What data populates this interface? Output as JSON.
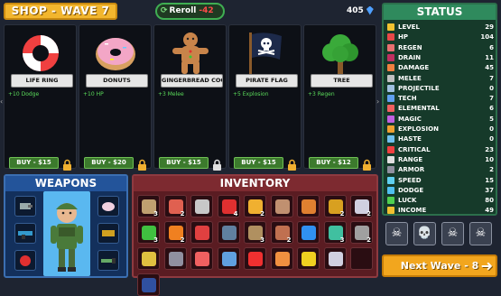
{
  "header": {
    "shop_title": "SHOP - WAVE 7",
    "reroll_label": "Reroll",
    "reroll_cost": "-42",
    "gold": "405"
  },
  "shop": [
    {
      "name": "LIFE RING",
      "effect": "+10 Dodge",
      "buy": "BUY - $15",
      "icon": "life-ring"
    },
    {
      "name": "DONUTS",
      "effect": "+10 HP",
      "buy": "BUY - $20",
      "icon": "donut"
    },
    {
      "name": "GINGERBREAD COOKIE",
      "effect": "+3 Melee",
      "buy": "BUY - $15",
      "icon": "gingerbread"
    },
    {
      "name": "PIRATE FLAG",
      "effect": "+5 Explosion",
      "buy": "BUY - $15",
      "icon": "pirate-flag"
    },
    {
      "name": "TREE",
      "effect": "+3 Regen",
      "buy": "BUY - $12",
      "icon": "tree"
    }
  ],
  "status": {
    "title": "STATUS",
    "stats": [
      {
        "label": "LEVEL",
        "value": "29",
        "color": "#f2c230"
      },
      {
        "label": "HP",
        "value": "104",
        "color": "#e84848"
      },
      {
        "label": "REGEN",
        "value": "6",
        "color": "#e87070"
      },
      {
        "label": "DRAIN",
        "value": "11",
        "color": "#c03060"
      },
      {
        "label": "DAMAGE",
        "value": "45",
        "color": "#f08040"
      },
      {
        "label": "MELEE",
        "value": "7",
        "color": "#c0c0c0"
      },
      {
        "label": "PROJECTILE",
        "value": "0",
        "color": "#a0c0e0"
      },
      {
        "label": "TECH",
        "value": "7",
        "color": "#60a0f0"
      },
      {
        "label": "ELEMENTAL",
        "value": "6",
        "color": "#f06060"
      },
      {
        "label": "MAGIC",
        "value": "5",
        "color": "#c060e0"
      },
      {
        "label": "EXPLOSION",
        "value": "0",
        "color": "#f0a030"
      },
      {
        "label": "HASTE",
        "value": "0",
        "color": "#70c0f0"
      },
      {
        "label": "CRITICAL",
        "value": "23",
        "color": "#f04040"
      },
      {
        "label": "RANGE",
        "value": "10",
        "color": "#e0e0e0"
      },
      {
        "label": "ARMOR",
        "value": "2",
        "color": "#9090a0"
      },
      {
        "label": "SPEED",
        "value": "15",
        "color": "#60d0f0"
      },
      {
        "label": "DODGE",
        "value": "37",
        "color": "#50c0f0"
      },
      {
        "label": "LUCK",
        "value": "80",
        "color": "#50d050"
      },
      {
        "label": "INCOME",
        "value": "49",
        "color": "#f0c030"
      }
    ]
  },
  "weapons": {
    "title": "WEAPONS"
  },
  "inventory": {
    "title": "INVENTORY",
    "items": [
      {
        "q": "3",
        "c": "#c0a070"
      },
      {
        "q": "2",
        "c": "#e06050"
      },
      {
        "q": "",
        "c": "#c8c8c8"
      },
      {
        "q": "4",
        "c": "#e03030"
      },
      {
        "q": "2",
        "c": "#f0b030"
      },
      {
        "q": "",
        "c": "#c09070"
      },
      {
        "q": "",
        "c": "#e08030"
      },
      {
        "q": "2",
        "c": "#d8a020"
      },
      {
        "q": "2",
        "c": "#d0d0e0"
      },
      {
        "q": "3",
        "c": "#40c040"
      },
      {
        "q": "2",
        "c": "#f08020"
      },
      {
        "q": "",
        "c": "#e04040"
      },
      {
        "q": "",
        "c": "#6080a0"
      },
      {
        "q": "3",
        "c": "#b09060"
      },
      {
        "q": "2",
        "c": "#c07050"
      },
      {
        "q": "",
        "c": "#3090f0"
      },
      {
        "q": "3",
        "c": "#40c0a0"
      },
      {
        "q": "2",
        "c": "#a0a0a0"
      },
      {
        "q": "",
        "c": "#e0c040"
      },
      {
        "q": "",
        "c": "#9090a0"
      },
      {
        "q": "",
        "c": "#f06060"
      },
      {
        "q": "",
        "c": "#60a0e0"
      },
      {
        "q": "",
        "c": "#f03030"
      },
      {
        "q": "",
        "c": "#f09040"
      },
      {
        "q": "",
        "c": "#f0d020"
      },
      {
        "q": "",
        "c": "#d0d0e0"
      },
      {
        "q": "",
        "c": ""
      },
      {
        "q": "",
        "c": "#3050a0"
      }
    ]
  },
  "abilities": [
    "skull-badge",
    "skull-icon",
    "skull-fire",
    "skull-alert"
  ],
  "next_wave": "Next Wave - 8"
}
